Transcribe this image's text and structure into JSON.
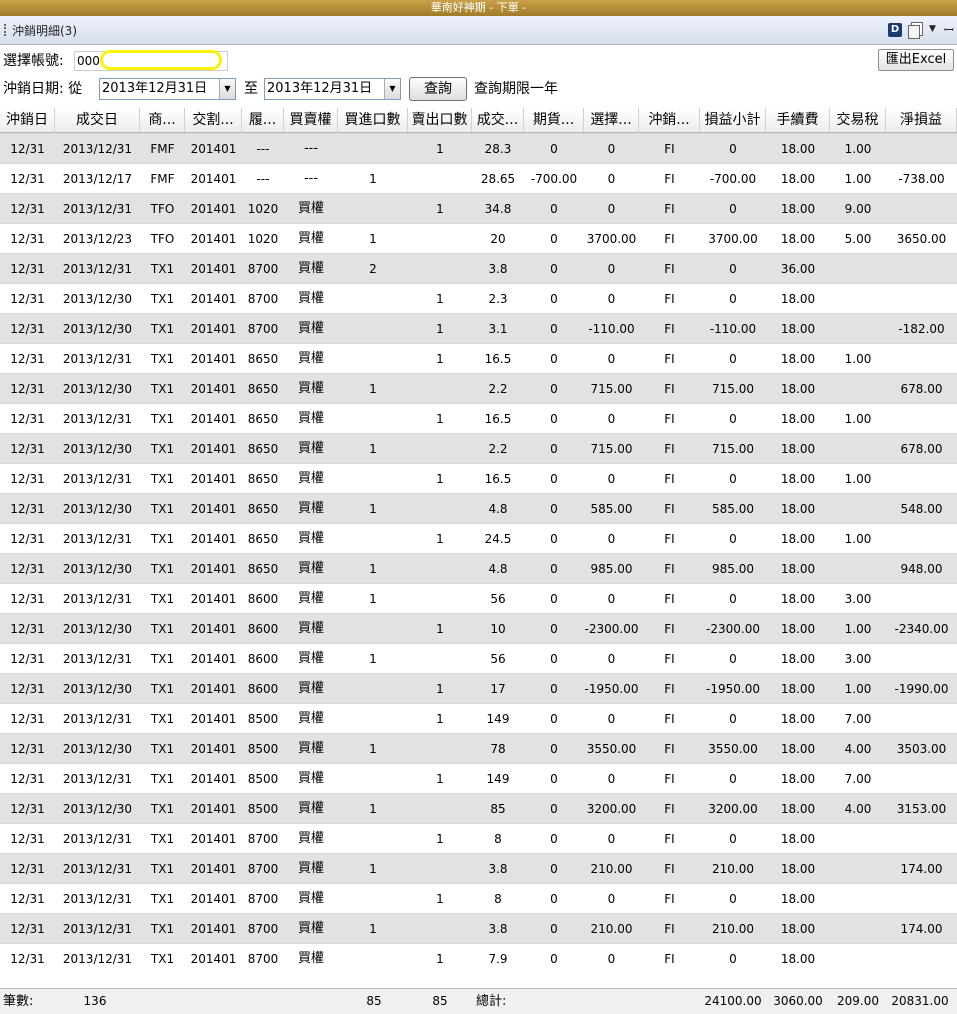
{
  "window": {
    "title": "華南好神期 - 下單 -"
  },
  "panel": {
    "title": "沖銷明細(3)",
    "d_label": "D"
  },
  "icons": {
    "d_icon": "d-badge-icon",
    "copy": "copy-window-icon",
    "dropdown": "chevron-down-icon",
    "pin": "pin-icon"
  },
  "query": {
    "account_label": "選擇帳號:",
    "account_value": "000",
    "date_label": "沖銷日期: 從",
    "date_from": "2013年12月31日",
    "to_label": "至",
    "date_to": "2013年12月31日",
    "query_button": "查詢",
    "limit_note": "查詢期限一年",
    "excel_button": "匯出Excel"
  },
  "columns": [
    "沖銷日",
    "成交日",
    "商...",
    "交割...",
    "履...",
    "買賣權",
    "買進口數",
    "賣出口數",
    "成交...",
    "期貨...",
    "選擇...",
    "沖銷...",
    "損益小計",
    "手續費",
    "交易稅",
    "淨損益"
  ],
  "rows": [
    [
      "12/31",
      "2013/12/31",
      "FMF",
      "201401",
      "---",
      "---",
      "",
      "1",
      "28.3",
      "0",
      "0",
      "FI",
      "0",
      "18.00",
      "1.00",
      ""
    ],
    [
      "12/31",
      "2013/12/17",
      "FMF",
      "201401",
      "---",
      "---",
      "1",
      "",
      "28.65",
      "-700.00",
      "0",
      "FI",
      "-700.00",
      "18.00",
      "1.00",
      "-738.00"
    ],
    [
      "12/31",
      "2013/12/31",
      "TFO",
      "201401",
      "1020",
      "買權",
      "",
      "1",
      "34.8",
      "0",
      "0",
      "FI",
      "0",
      "18.00",
      "9.00",
      ""
    ],
    [
      "12/31",
      "2013/12/23",
      "TFO",
      "201401",
      "1020",
      "買權",
      "1",
      "",
      "20",
      "0",
      "3700.00",
      "FI",
      "3700.00",
      "18.00",
      "5.00",
      "3650.00"
    ],
    [
      "12/31",
      "2013/12/31",
      "TX1",
      "201401",
      "8700",
      "買權",
      "2",
      "",
      "3.8",
      "0",
      "0",
      "FI",
      "0",
      "36.00",
      "",
      ""
    ],
    [
      "12/31",
      "2013/12/30",
      "TX1",
      "201401",
      "8700",
      "買權",
      "",
      "1",
      "2.3",
      "0",
      "0",
      "FI",
      "0",
      "18.00",
      "",
      ""
    ],
    [
      "12/31",
      "2013/12/30",
      "TX1",
      "201401",
      "8700",
      "買權",
      "",
      "1",
      "3.1",
      "0",
      "-110.00",
      "FI",
      "-110.00",
      "18.00",
      "",
      "-182.00"
    ],
    [
      "12/31",
      "2013/12/31",
      "TX1",
      "201401",
      "8650",
      "買權",
      "",
      "1",
      "16.5",
      "0",
      "0",
      "FI",
      "0",
      "18.00",
      "1.00",
      ""
    ],
    [
      "12/31",
      "2013/12/30",
      "TX1",
      "201401",
      "8650",
      "買權",
      "1",
      "",
      "2.2",
      "0",
      "715.00",
      "FI",
      "715.00",
      "18.00",
      "",
      "678.00"
    ],
    [
      "12/31",
      "2013/12/31",
      "TX1",
      "201401",
      "8650",
      "買權",
      "",
      "1",
      "16.5",
      "0",
      "0",
      "FI",
      "0",
      "18.00",
      "1.00",
      ""
    ],
    [
      "12/31",
      "2013/12/30",
      "TX1",
      "201401",
      "8650",
      "買權",
      "1",
      "",
      "2.2",
      "0",
      "715.00",
      "FI",
      "715.00",
      "18.00",
      "",
      "678.00"
    ],
    [
      "12/31",
      "2013/12/31",
      "TX1",
      "201401",
      "8650",
      "買權",
      "",
      "1",
      "16.5",
      "0",
      "0",
      "FI",
      "0",
      "18.00",
      "1.00",
      ""
    ],
    [
      "12/31",
      "2013/12/30",
      "TX1",
      "201401",
      "8650",
      "買權",
      "1",
      "",
      "4.8",
      "0",
      "585.00",
      "FI",
      "585.00",
      "18.00",
      "",
      "548.00"
    ],
    [
      "12/31",
      "2013/12/31",
      "TX1",
      "201401",
      "8650",
      "買權",
      "",
      "1",
      "24.5",
      "0",
      "0",
      "FI",
      "0",
      "18.00",
      "1.00",
      ""
    ],
    [
      "12/31",
      "2013/12/30",
      "TX1",
      "201401",
      "8650",
      "買權",
      "1",
      "",
      "4.8",
      "0",
      "985.00",
      "FI",
      "985.00",
      "18.00",
      "",
      "948.00"
    ],
    [
      "12/31",
      "2013/12/31",
      "TX1",
      "201401",
      "8600",
      "買權",
      "1",
      "",
      "56",
      "0",
      "0",
      "FI",
      "0",
      "18.00",
      "3.00",
      ""
    ],
    [
      "12/31",
      "2013/12/30",
      "TX1",
      "201401",
      "8600",
      "買權",
      "",
      "1",
      "10",
      "0",
      "-2300.00",
      "FI",
      "-2300.00",
      "18.00",
      "1.00",
      "-2340.00"
    ],
    [
      "12/31",
      "2013/12/31",
      "TX1",
      "201401",
      "8600",
      "買權",
      "1",
      "",
      "56",
      "0",
      "0",
      "FI",
      "0",
      "18.00",
      "3.00",
      ""
    ],
    [
      "12/31",
      "2013/12/30",
      "TX1",
      "201401",
      "8600",
      "買權",
      "",
      "1",
      "17",
      "0",
      "-1950.00",
      "FI",
      "-1950.00",
      "18.00",
      "1.00",
      "-1990.00"
    ],
    [
      "12/31",
      "2013/12/31",
      "TX1",
      "201401",
      "8500",
      "買權",
      "",
      "1",
      "149",
      "0",
      "0",
      "FI",
      "0",
      "18.00",
      "7.00",
      ""
    ],
    [
      "12/31",
      "2013/12/30",
      "TX1",
      "201401",
      "8500",
      "買權",
      "1",
      "",
      "78",
      "0",
      "3550.00",
      "FI",
      "3550.00",
      "18.00",
      "4.00",
      "3503.00"
    ],
    [
      "12/31",
      "2013/12/31",
      "TX1",
      "201401",
      "8500",
      "買權",
      "",
      "1",
      "149",
      "0",
      "0",
      "FI",
      "0",
      "18.00",
      "7.00",
      ""
    ],
    [
      "12/31",
      "2013/12/30",
      "TX1",
      "201401",
      "8500",
      "買權",
      "1",
      "",
      "85",
      "0",
      "3200.00",
      "FI",
      "3200.00",
      "18.00",
      "4.00",
      "3153.00"
    ],
    [
      "12/31",
      "2013/12/31",
      "TX1",
      "201401",
      "8700",
      "買權",
      "",
      "1",
      "8",
      "0",
      "0",
      "FI",
      "0",
      "18.00",
      "",
      ""
    ],
    [
      "12/31",
      "2013/12/31",
      "TX1",
      "201401",
      "8700",
      "買權",
      "1",
      "",
      "3.8",
      "0",
      "210.00",
      "FI",
      "210.00",
      "18.00",
      "",
      "174.00"
    ],
    [
      "12/31",
      "2013/12/31",
      "TX1",
      "201401",
      "8700",
      "買權",
      "",
      "1",
      "8",
      "0",
      "0",
      "FI",
      "0",
      "18.00",
      "",
      ""
    ],
    [
      "12/31",
      "2013/12/31",
      "TX1",
      "201401",
      "8700",
      "買權",
      "1",
      "",
      "3.8",
      "0",
      "210.00",
      "FI",
      "210.00",
      "18.00",
      "",
      "174.00"
    ],
    [
      "12/31",
      "2013/12/31",
      "TX1",
      "201401",
      "8700",
      "買權",
      "",
      "1",
      "7.9",
      "0",
      "0",
      "FI",
      "0",
      "18.00",
      "",
      ""
    ]
  ],
  "footer": {
    "count_label": "筆數:",
    "count_value": "136",
    "buy_total": "85",
    "sell_total": "85",
    "total_label": "總計:",
    "pl_total": "24100.00",
    "fee_total": "3060.00",
    "tax_total": "209.00",
    "net_total": "20831.00"
  },
  "colors": {
    "title_bar": "#b08a34",
    "row_shade": "#e2e2e2",
    "redaction": "#f7f30a"
  }
}
